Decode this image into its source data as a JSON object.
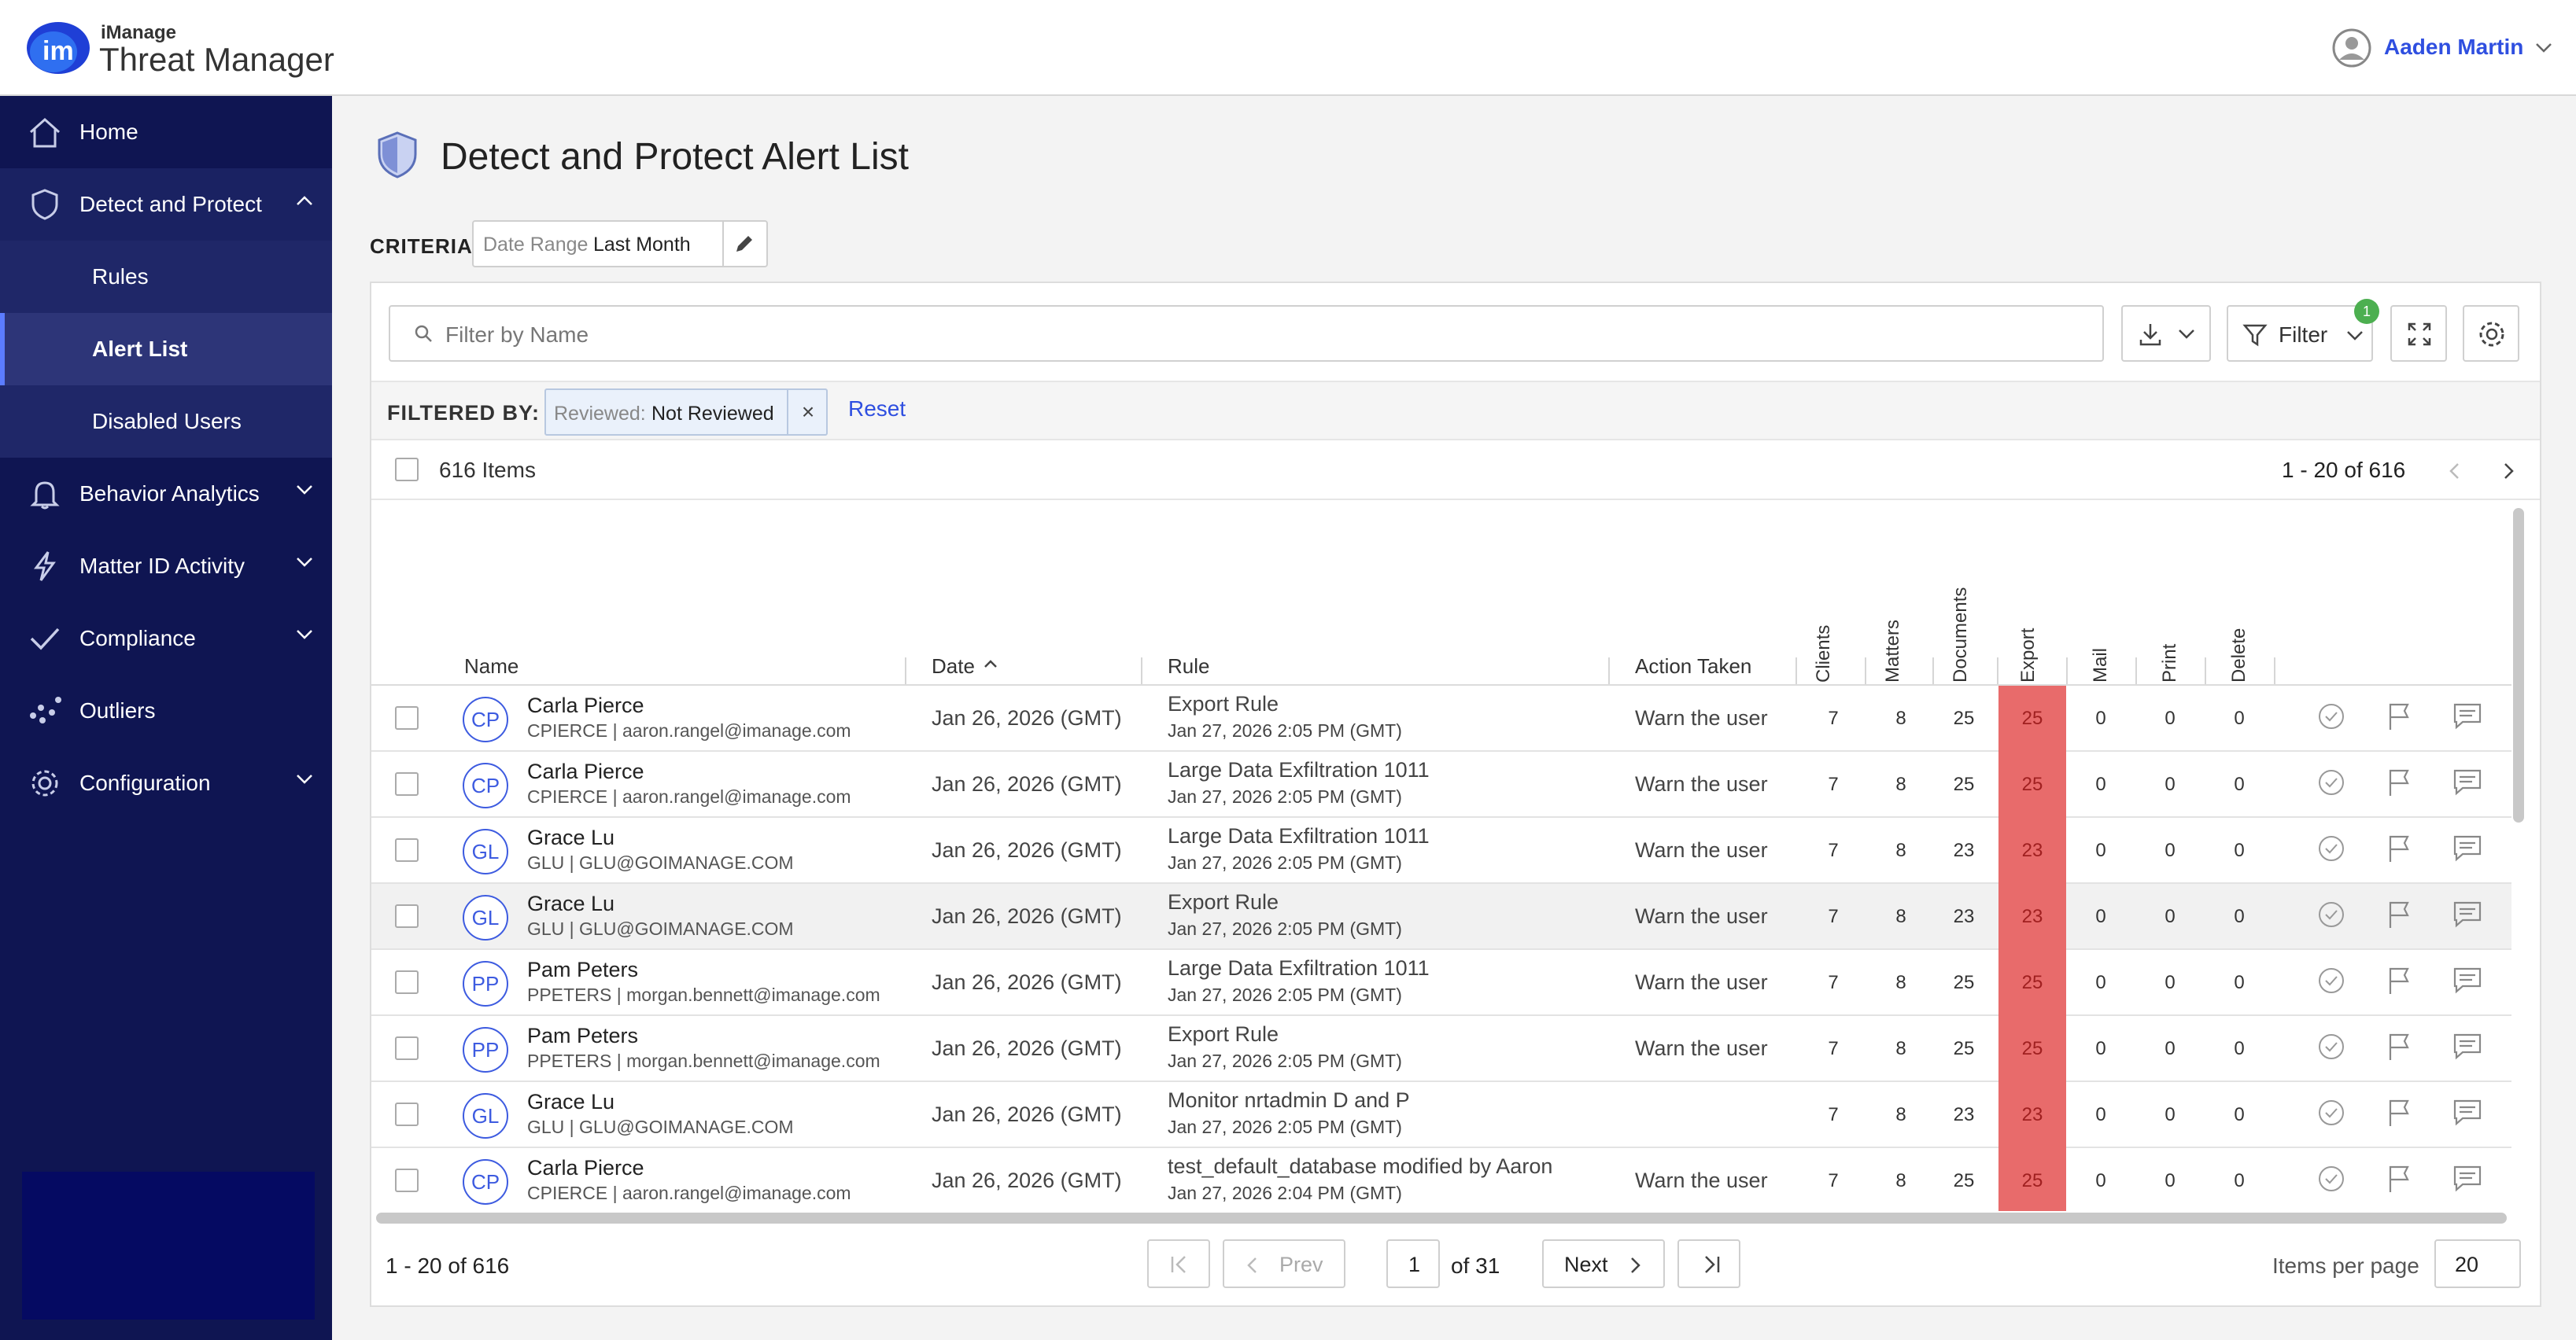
{
  "brand": {
    "small": "iManage",
    "product": "Threat Manager"
  },
  "user": {
    "name": "Aaden Martin"
  },
  "sidebar": {
    "items": [
      {
        "label": "Home"
      },
      {
        "label": "Detect and Protect"
      },
      {
        "label": "Rules"
      },
      {
        "label": "Alert List"
      },
      {
        "label": "Disabled Users"
      },
      {
        "label": "Behavior Analytics"
      },
      {
        "label": "Matter ID Activity"
      },
      {
        "label": "Compliance"
      },
      {
        "label": "Outliers"
      },
      {
        "label": "Configuration"
      }
    ]
  },
  "page": {
    "title": "Detect and Protect Alert List"
  },
  "criteria": {
    "label": "CRITERIA",
    "key": "Date Range",
    "value": "Last Month"
  },
  "toolbar": {
    "search_placeholder": "Filter by Name",
    "filter_label": "Filter",
    "filter_badge": "1"
  },
  "filtered": {
    "label": "FILTERED BY:",
    "chip_key": "Reviewed:",
    "chip_value": "Not Reviewed",
    "chip_close": "×",
    "reset": "Reset"
  },
  "list": {
    "count": "616 Items",
    "range": "1 - 20 of 616"
  },
  "table": {
    "headers": {
      "name": "Name",
      "date": "Date",
      "rule": "Rule",
      "action": "Action Taken",
      "clients": "Clients",
      "matters": "Matters",
      "documents": "Documents",
      "export": "Export",
      "mail": "Mail",
      "print": "Print",
      "delete": "Delete"
    },
    "rows": [
      {
        "initials": "CP",
        "name": "Carla Pierce",
        "sub": "CPIERCE | aaron.rangel@imanage.com",
        "date": "Jan 26, 2026 (GMT)",
        "rule": "Export Rule",
        "rule_time": "Jan 27, 2026 2:05 PM (GMT)",
        "action": "Warn the user",
        "clients": "7",
        "matters": "8",
        "documents": "25",
        "export": "25",
        "mail": "0",
        "print": "0",
        "delete": "0"
      },
      {
        "initials": "CP",
        "name": "Carla Pierce",
        "sub": "CPIERCE | aaron.rangel@imanage.com",
        "date": "Jan 26, 2026 (GMT)",
        "rule": "Large Data Exfiltration 1011",
        "rule_time": "Jan 27, 2026 2:05 PM (GMT)",
        "action": "Warn the user",
        "clients": "7",
        "matters": "8",
        "documents": "25",
        "export": "25",
        "mail": "0",
        "print": "0",
        "delete": "0"
      },
      {
        "initials": "GL",
        "name": "Grace Lu",
        "sub": "GLU | GLU@GOIMANAGE.COM",
        "date": "Jan 26, 2026 (GMT)",
        "rule": "Large Data Exfiltration 1011",
        "rule_time": "Jan 27, 2026 2:05 PM (GMT)",
        "action": "Warn the user",
        "clients": "7",
        "matters": "8",
        "documents": "23",
        "export": "23",
        "mail": "0",
        "print": "0",
        "delete": "0"
      },
      {
        "initials": "GL",
        "name": "Grace Lu",
        "sub": "GLU | GLU@GOIMANAGE.COM",
        "date": "Jan 26, 2026 (GMT)",
        "rule": "Export Rule",
        "rule_time": "Jan 27, 2026 2:05 PM (GMT)",
        "action": "Warn the user",
        "clients": "7",
        "matters": "8",
        "documents": "23",
        "export": "23",
        "mail": "0",
        "print": "0",
        "delete": "0"
      },
      {
        "initials": "PP",
        "name": "Pam Peters",
        "sub": "PPETERS | morgan.bennett@imanage.com",
        "date": "Jan 26, 2026 (GMT)",
        "rule": "Large Data Exfiltration 1011",
        "rule_time": "Jan 27, 2026 2:05 PM (GMT)",
        "action": "Warn the user",
        "clients": "7",
        "matters": "8",
        "documents": "25",
        "export": "25",
        "mail": "0",
        "print": "0",
        "delete": "0"
      },
      {
        "initials": "PP",
        "name": "Pam Peters",
        "sub": "PPETERS | morgan.bennett@imanage.com",
        "date": "Jan 26, 2026 (GMT)",
        "rule": "Export Rule",
        "rule_time": "Jan 27, 2026 2:05 PM (GMT)",
        "action": "Warn the user",
        "clients": "7",
        "matters": "8",
        "documents": "25",
        "export": "25",
        "mail": "0",
        "print": "0",
        "delete": "0"
      },
      {
        "initials": "GL",
        "name": "Grace Lu",
        "sub": "GLU | GLU@GOIMANAGE.COM",
        "date": "Jan 26, 2026 (GMT)",
        "rule": "Monitor nrtadmin D and P",
        "rule_time": "Jan 27, 2026 2:05 PM (GMT)",
        "action": "",
        "clients": "7",
        "matters": "8",
        "documents": "23",
        "export": "23",
        "mail": "0",
        "print": "0",
        "delete": "0"
      },
      {
        "initials": "CP",
        "name": "Carla Pierce",
        "sub": "CPIERCE | aaron.rangel@imanage.com",
        "date": "Jan 26, 2026 (GMT)",
        "rule": "test_default_database modified by Aaron",
        "rule_time": "Jan 27, 2026 2:04 PM (GMT)",
        "action": "Warn the user",
        "clients": "7",
        "matters": "8",
        "documents": "25",
        "export": "25",
        "mail": "0",
        "print": "0",
        "delete": "0"
      }
    ]
  },
  "pagination": {
    "range": "1 - 20 of 616",
    "prev": "Prev",
    "page": "1",
    "of": "of 31",
    "next": "Next",
    "items_per_page_label": "Items per page",
    "items_per_page": "20"
  },
  "colors": {
    "brand_blue": "#2f4fe0",
    "sidebar": "#0f1552",
    "export_highlight": "#e86b6b"
  }
}
